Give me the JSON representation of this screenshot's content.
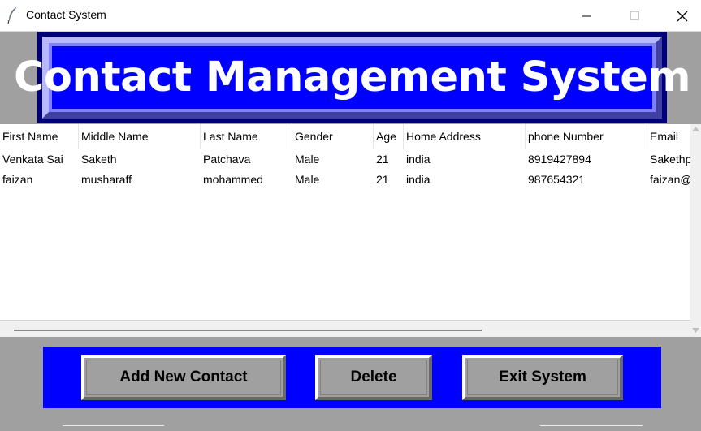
{
  "window": {
    "title": "Contact System",
    "icon": "feather-icon",
    "controls": [
      "minimize-icon",
      "maximize-icon",
      "close-icon"
    ]
  },
  "banner": {
    "title": "Contact Management System",
    "colors": {
      "background": "#0000ff",
      "text": "#ffffff",
      "frame": "#00007a"
    }
  },
  "table": {
    "columns": [
      "First Name",
      "Middle Name",
      "Last Name",
      "Gender",
      "Age",
      "Home Address",
      "phone Number",
      "Email"
    ],
    "rows": [
      [
        "Venkata Sai",
        "Saketh",
        "Patchava",
        "Male",
        "21",
        "india",
        "8919427894",
        "Sakethp"
      ],
      [
        "faizan",
        "musharaff",
        "mohammed",
        "Male",
        "21",
        "india",
        "987654321",
        "faizan@"
      ]
    ]
  },
  "buttons": {
    "add": "Add New Contact",
    "delete": "Delete",
    "exit": "Exit System"
  },
  "colors": {
    "window_bg": "#a0a0a0",
    "button_panel": "#0000ff",
    "button_face": "#a0a0a0"
  }
}
